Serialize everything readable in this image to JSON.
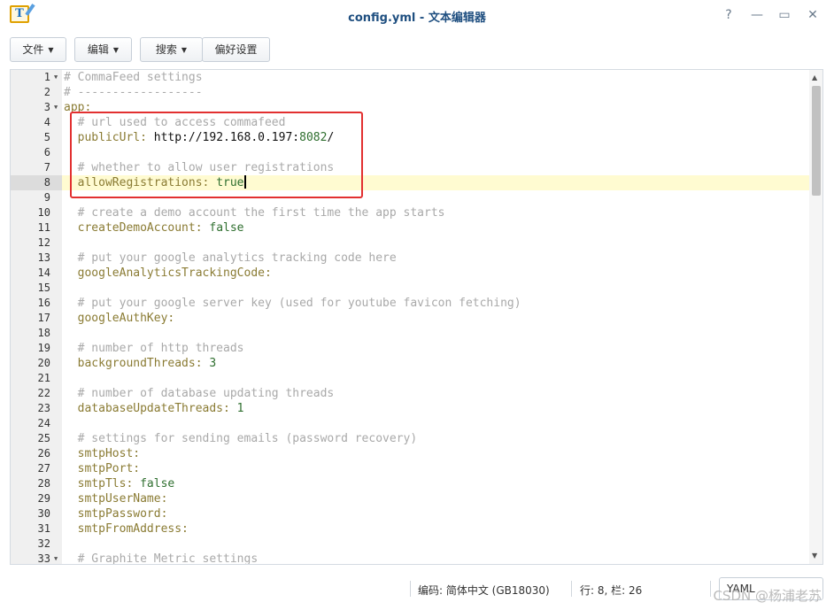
{
  "window": {
    "title": "config.yml - 文本编辑器",
    "app_icon": "text-editor-icon",
    "controls": [
      "?",
      "—",
      "▭",
      "✕"
    ]
  },
  "toolbar": {
    "file_label": "文件",
    "edit_label": "编辑",
    "search_label": "搜索",
    "prefs_label": "偏好设置"
  },
  "editor": {
    "active_line": 8,
    "lines": [
      {
        "n": "1",
        "fold": true,
        "parts": [
          {
            "t": "# CommaFeed settings",
            "c": "comment"
          }
        ]
      },
      {
        "n": "2",
        "fold": false,
        "parts": [
          {
            "t": "# ------------------",
            "c": "comment"
          }
        ]
      },
      {
        "n": "3",
        "fold": true,
        "parts": [
          {
            "t": "app:",
            "c": "key"
          }
        ]
      },
      {
        "n": "4",
        "fold": false,
        "parts": [
          {
            "t": "  # url used to access commafeed",
            "c": "comment"
          }
        ]
      },
      {
        "n": "5",
        "fold": false,
        "parts": [
          {
            "t": "  publicUrl: ",
            "c": "key"
          },
          {
            "t": "http://192.168.0.197:",
            "c": "str"
          },
          {
            "t": "8082",
            "c": "val"
          },
          {
            "t": "/",
            "c": "str"
          }
        ]
      },
      {
        "n": "6",
        "fold": false,
        "parts": []
      },
      {
        "n": "7",
        "fold": false,
        "parts": [
          {
            "t": "  # whether to allow user registrations",
            "c": "comment"
          }
        ]
      },
      {
        "n": "8",
        "fold": false,
        "parts": [
          {
            "t": "  allowRegistrations: ",
            "c": "key"
          },
          {
            "t": "true",
            "c": "val"
          }
        ],
        "cursor": true
      },
      {
        "n": "9",
        "fold": false,
        "parts": []
      },
      {
        "n": "10",
        "fold": false,
        "parts": [
          {
            "t": "  # create a demo account the first time the app starts",
            "c": "comment"
          }
        ]
      },
      {
        "n": "11",
        "fold": false,
        "parts": [
          {
            "t": "  createDemoAccount: ",
            "c": "key"
          },
          {
            "t": "false",
            "c": "val"
          }
        ]
      },
      {
        "n": "12",
        "fold": false,
        "parts": []
      },
      {
        "n": "13",
        "fold": false,
        "parts": [
          {
            "t": "  # put your google analytics tracking code here",
            "c": "comment"
          }
        ]
      },
      {
        "n": "14",
        "fold": false,
        "parts": [
          {
            "t": "  googleAnalyticsTrackingCode:",
            "c": "key"
          }
        ]
      },
      {
        "n": "15",
        "fold": false,
        "parts": []
      },
      {
        "n": "16",
        "fold": false,
        "parts": [
          {
            "t": "  # put your google server key (used for youtube favicon fetching)",
            "c": "comment"
          }
        ]
      },
      {
        "n": "17",
        "fold": false,
        "parts": [
          {
            "t": "  googleAuthKey:",
            "c": "key"
          }
        ]
      },
      {
        "n": "18",
        "fold": false,
        "parts": []
      },
      {
        "n": "19",
        "fold": false,
        "parts": [
          {
            "t": "  # number of http threads",
            "c": "comment"
          }
        ]
      },
      {
        "n": "20",
        "fold": false,
        "parts": [
          {
            "t": "  backgroundThreads: ",
            "c": "key"
          },
          {
            "t": "3",
            "c": "val"
          }
        ]
      },
      {
        "n": "21",
        "fold": false,
        "parts": []
      },
      {
        "n": "22",
        "fold": false,
        "parts": [
          {
            "t": "  # number of database updating threads",
            "c": "comment"
          }
        ]
      },
      {
        "n": "23",
        "fold": false,
        "parts": [
          {
            "t": "  databaseUpdateThreads: ",
            "c": "key"
          },
          {
            "t": "1",
            "c": "val"
          }
        ]
      },
      {
        "n": "24",
        "fold": false,
        "parts": []
      },
      {
        "n": "25",
        "fold": false,
        "parts": [
          {
            "t": "  # settings for sending emails (password recovery)",
            "c": "comment"
          }
        ]
      },
      {
        "n": "26",
        "fold": false,
        "parts": [
          {
            "t": "  smtpHost:",
            "c": "key"
          }
        ]
      },
      {
        "n": "27",
        "fold": false,
        "parts": [
          {
            "t": "  smtpPort:",
            "c": "key"
          }
        ]
      },
      {
        "n": "28",
        "fold": false,
        "parts": [
          {
            "t": "  smtpTls: ",
            "c": "key"
          },
          {
            "t": "false",
            "c": "val"
          }
        ]
      },
      {
        "n": "29",
        "fold": false,
        "parts": [
          {
            "t": "  smtpUserName:",
            "c": "key"
          }
        ]
      },
      {
        "n": "30",
        "fold": false,
        "parts": [
          {
            "t": "  smtpPassword:",
            "c": "key"
          }
        ]
      },
      {
        "n": "31",
        "fold": false,
        "parts": [
          {
            "t": "  smtpFromAddress:",
            "c": "key"
          }
        ]
      },
      {
        "n": "32",
        "fold": false,
        "parts": []
      },
      {
        "n": "33",
        "fold": true,
        "parts": [
          {
            "t": "  # Graphite Metric settings",
            "c": "comment"
          }
        ]
      }
    ]
  },
  "status": {
    "encoding": "编码: 简体中文 (GB18030)",
    "position": "行: 8, 栏: 26",
    "mode": "YAML"
  },
  "watermark": "CSDN @杨浦老苏"
}
